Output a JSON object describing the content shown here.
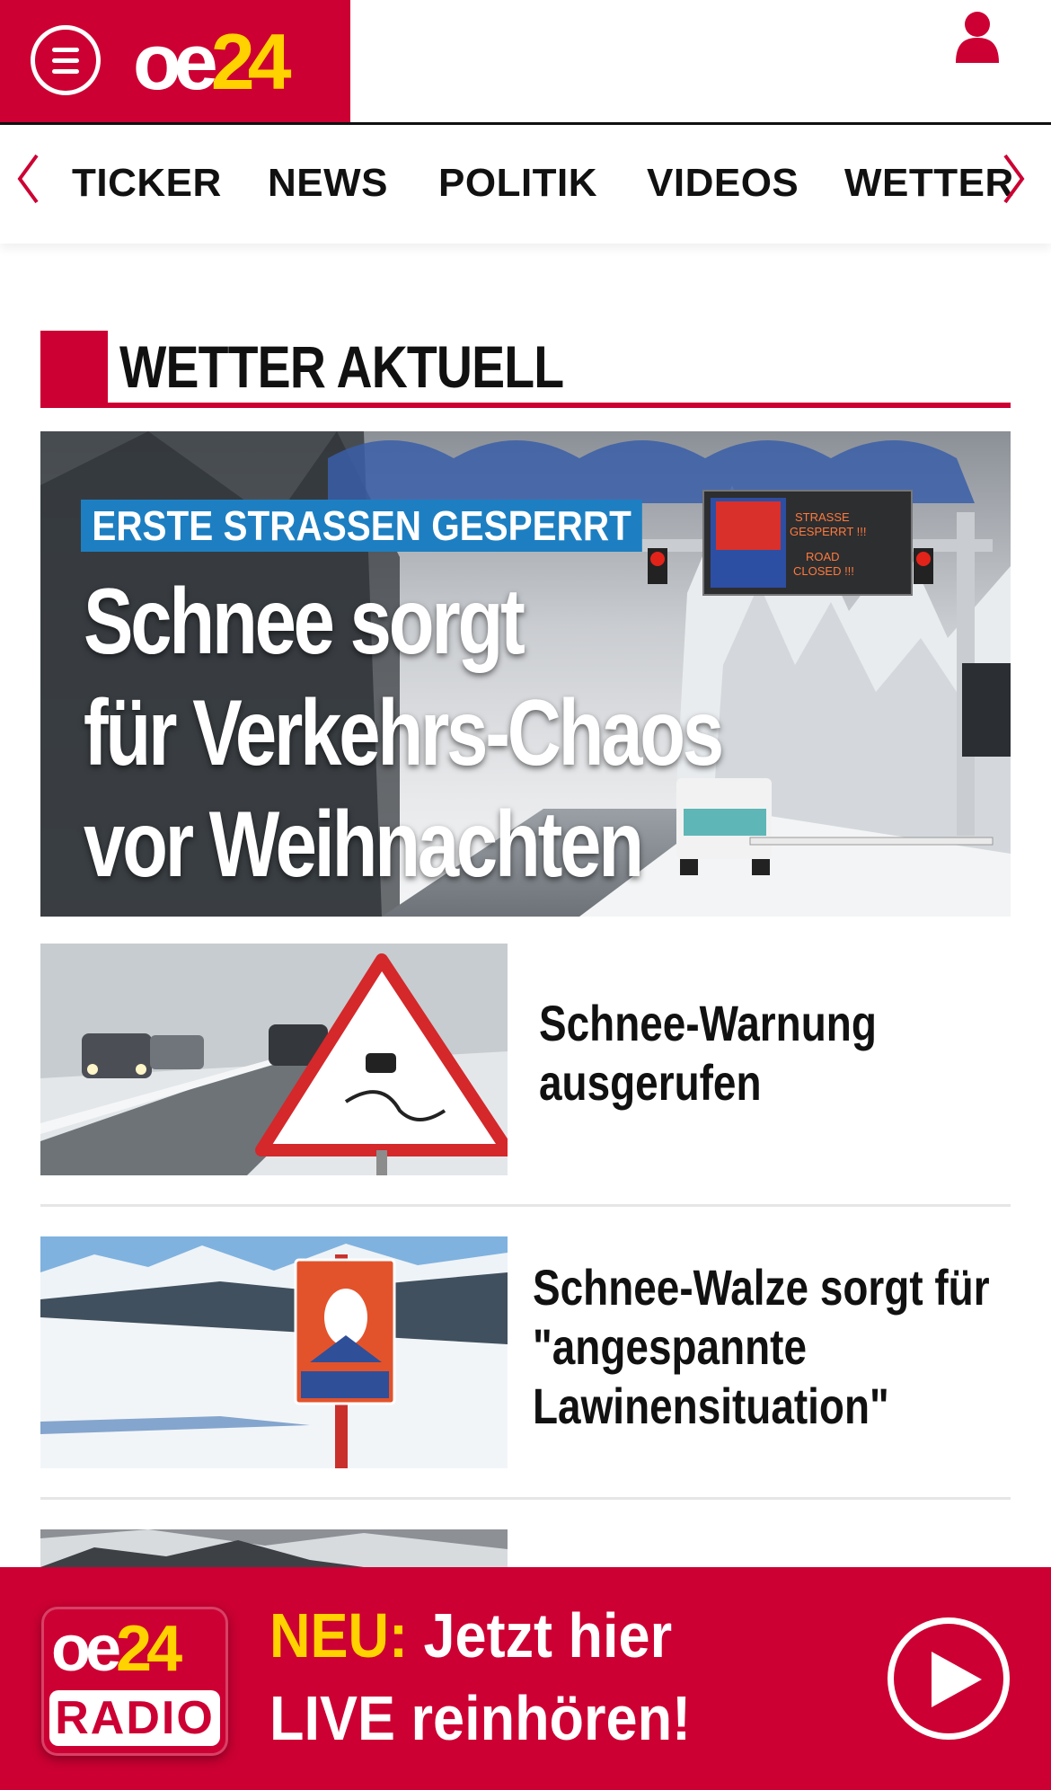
{
  "header": {
    "logo_oe": "oe",
    "logo_num": "24",
    "menu_icon": "hamburger-menu-icon",
    "user_icon": "user-icon",
    "brand_color": "#cc0033",
    "accent_color": "#ffd200"
  },
  "nav": {
    "items": [
      "TICKER",
      "NEWS",
      "POLITIK",
      "VIDEOS",
      "WETTER"
    ],
    "prev_icon": "chevron-left-icon",
    "next_icon": "chevron-right-icon"
  },
  "section": {
    "title": "WETTER AKTUELL"
  },
  "hero": {
    "tag": "ERSTE STRASSEN GESPERRT",
    "headline_line1": "Schnee sorgt",
    "headline_line2": "für Verkehrs-Chaos",
    "headline_line3": "vor Weihnachten",
    "sign_text1": "STRASSE",
    "sign_text2": "GESPERRT !!!",
    "sign_text3": "ROAD",
    "sign_text4": "CLOSED !!!"
  },
  "articles": [
    {
      "line1": "Schnee-Warnung",
      "line2": "ausgerufen",
      "line3": ""
    },
    {
      "line1": "Schnee-Walze sorgt für",
      "line2": "\"angespannte",
      "line3": "Lawinensituation\""
    }
  ],
  "radio": {
    "logo_oe": "oe",
    "logo_num": "24",
    "logo_label": "RADIO",
    "neu": "NEU:",
    "line1_rest": " Jetzt hier",
    "line2": "LIVE reinhören!",
    "play_icon": "play-icon"
  }
}
